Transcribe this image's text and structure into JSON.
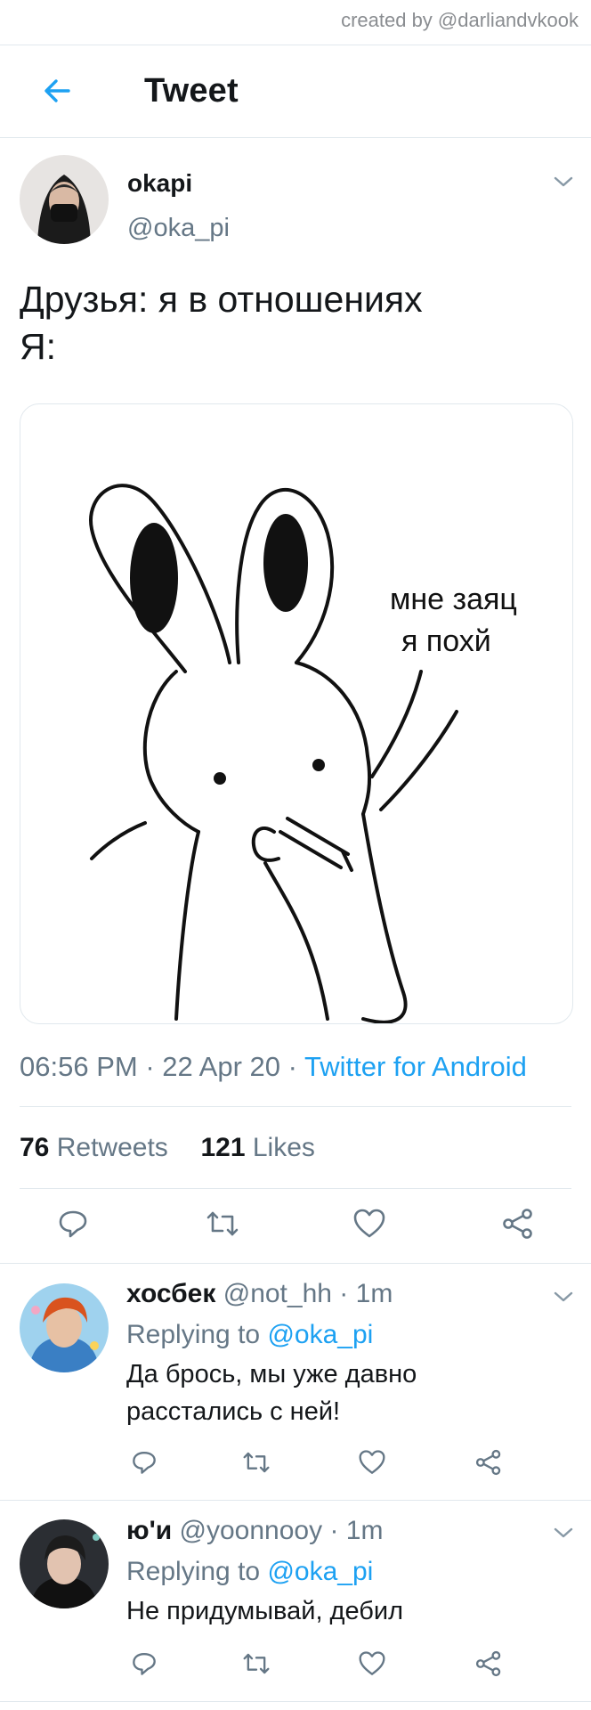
{
  "credit": "created by @darliandvkook",
  "header": {
    "title": "Tweet"
  },
  "tweet": {
    "name": "okapi",
    "handle": "@oka_pi",
    "text": "Друзья: я в отношениях\nЯ:",
    "image_caption_line1": "мне заяц",
    "image_caption_line2": "я похй",
    "time": "06:56 PM",
    "date": "22 Apr 20",
    "client": "Twitter for Android",
    "retweets_count": "76",
    "retweets_label": "Retweets",
    "likes_count": "121",
    "likes_label": "Likes"
  },
  "replies": [
    {
      "name": "хосбек",
      "handle": "@not_hh",
      "time": "1m",
      "replying_label": "Replying to",
      "replying_to": "@oka_pi",
      "text": "Да брось, мы уже давно расстались с ней!"
    },
    {
      "name": "ю'и",
      "handle": "@yoonnooy",
      "time": "1m",
      "replying_label": "Replying to",
      "replying_to": "@oka_pi",
      "text": "Не придумывай, дебил"
    }
  ],
  "colors": {
    "accent": "#1da1f2",
    "muted": "#657786",
    "border": "#e1e8ed"
  },
  "icons": [
    "back-arrow-icon",
    "chevron-down-icon",
    "reply-icon",
    "retweet-icon",
    "like-icon",
    "share-icon"
  ]
}
